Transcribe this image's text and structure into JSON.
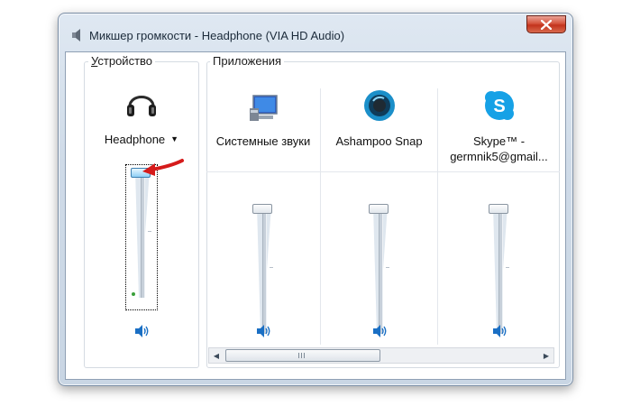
{
  "window": {
    "title": "Микшер громкости - Headphone (VIA HD Audio)",
    "close_label": "close"
  },
  "device_group": {
    "label_underlined": "У",
    "label_rest": "стройство"
  },
  "apps_group": {
    "label": "Приложения"
  },
  "device": {
    "name": "Headphone",
    "icon": "headphones-icon",
    "volume_level": 1.0
  },
  "applications": [
    {
      "name": "Системные звуки",
      "icon": "system-sounds-icon",
      "volume_level": 1.0
    },
    {
      "name": "Ashampoo Snap",
      "icon": "ashampoo-snap-icon",
      "volume_level": 1.0
    },
    {
      "name_line1": "Skype™ -",
      "name_line2": "germnik5@gmail...",
      "icon": "skype-icon",
      "volume_level": 1.0
    }
  ],
  "colors": {
    "accent_blue": "#1a6fc4",
    "close_red": "#c3321c",
    "annotation_red": "#d51b1b"
  }
}
